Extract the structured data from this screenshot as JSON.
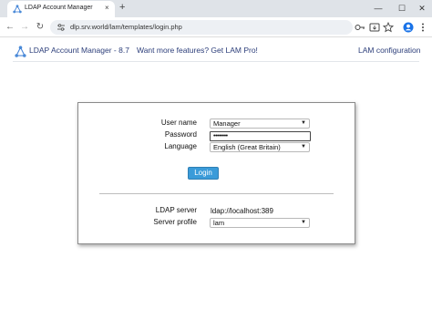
{
  "browser": {
    "tab_title": "LDAP Account Manager",
    "tab_close": "×",
    "new_tab": "+",
    "url": "dlp.srv.world/lam/templates/login.php",
    "window_controls": {
      "minimize": "—",
      "maximize": "☐",
      "close": "✕"
    },
    "nav": {
      "back": "←",
      "forward": "→",
      "reload": "↻"
    },
    "icons": [
      "tune-icon",
      "password-key-icon",
      "install-app-icon",
      "bookmark-star-icon",
      "profile-icon",
      "menu-icon"
    ]
  },
  "header": {
    "app_title": "LDAP Account Manager - 8.7",
    "promo_link": "Want more features? Get LAM Pro!",
    "config_link": "LAM configuration"
  },
  "login": {
    "username_label": "User name",
    "username_value": "Manager",
    "password_label": "Password",
    "password_value": "••••••••",
    "language_label": "Language",
    "language_value": "English (Great Britain)",
    "login_button": "Login",
    "server_label": "LDAP server",
    "server_value": "ldap://localhost:389",
    "profile_label": "Server profile",
    "profile_value": "lam"
  },
  "colors": {
    "accent": "#3a9bd9",
    "link": "#2c3e7a",
    "profile_avatar": "#1a73e8"
  }
}
